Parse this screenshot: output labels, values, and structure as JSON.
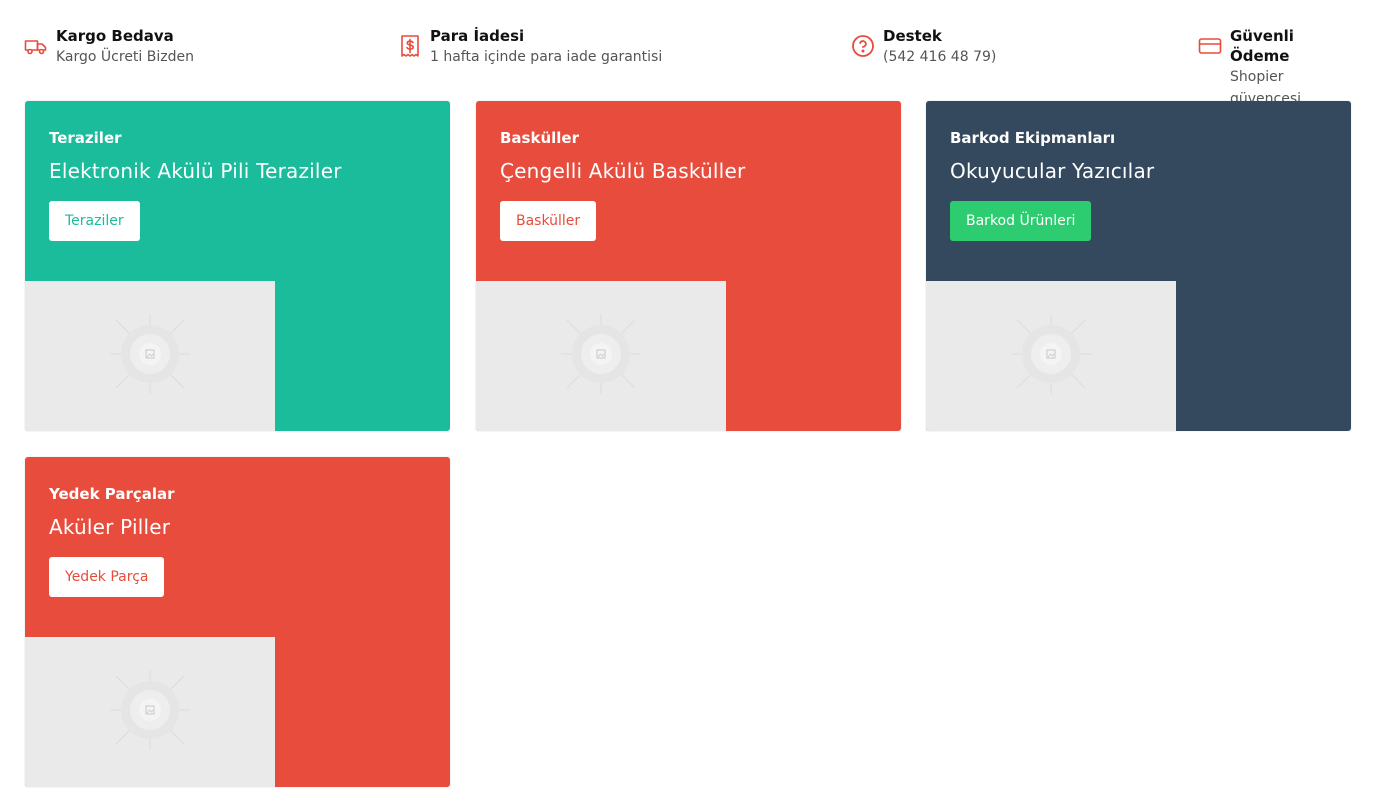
{
  "features": [
    {
      "title": "Kargo Bedava",
      "subtitle": "Kargo Ücreti Bizden",
      "icon": "truck-icon"
    },
    {
      "title": "Para İadesi",
      "subtitle": "1 hafta içinde para iade garantisi",
      "icon": "receipt-icon"
    },
    {
      "title": "Destek",
      "subtitle": "(542 416 48 79)",
      "icon": "help-circle-icon"
    },
    {
      "title": "Güvenli Ödeme",
      "subtitle": "Shopier güvencesi",
      "icon": "credit-card-icon"
    }
  ],
  "accent_color": "#e74c3c",
  "cards": [
    {
      "category": "Teraziler",
      "headline": "Elektronik Akülü Pili Teraziler",
      "button": "Teraziler",
      "bg": "#1abc9c",
      "button_text_color": "#1abc9c",
      "button_bg": "#ffffff"
    },
    {
      "category": "Basküller",
      "headline": "Çengelli Akülü Basküller",
      "button": "Basküller",
      "bg": "#e74c3c",
      "button_text_color": "#e74c3c",
      "button_bg": "#ffffff"
    },
    {
      "category": "Barkod Ekipmanları",
      "headline": "Okuyucular Yazıcılar",
      "button": "Barkod Ürünleri",
      "bg": "#34495e",
      "button_text_color": "#ffffff",
      "button_bg": "#2ecc71"
    },
    {
      "category": "Yedek Parçalar",
      "headline": "Aküler Piller",
      "button": "Yedek Parça",
      "bg": "#e74c3c",
      "button_text_color": "#e74c3c",
      "button_bg": "#ffffff"
    }
  ]
}
